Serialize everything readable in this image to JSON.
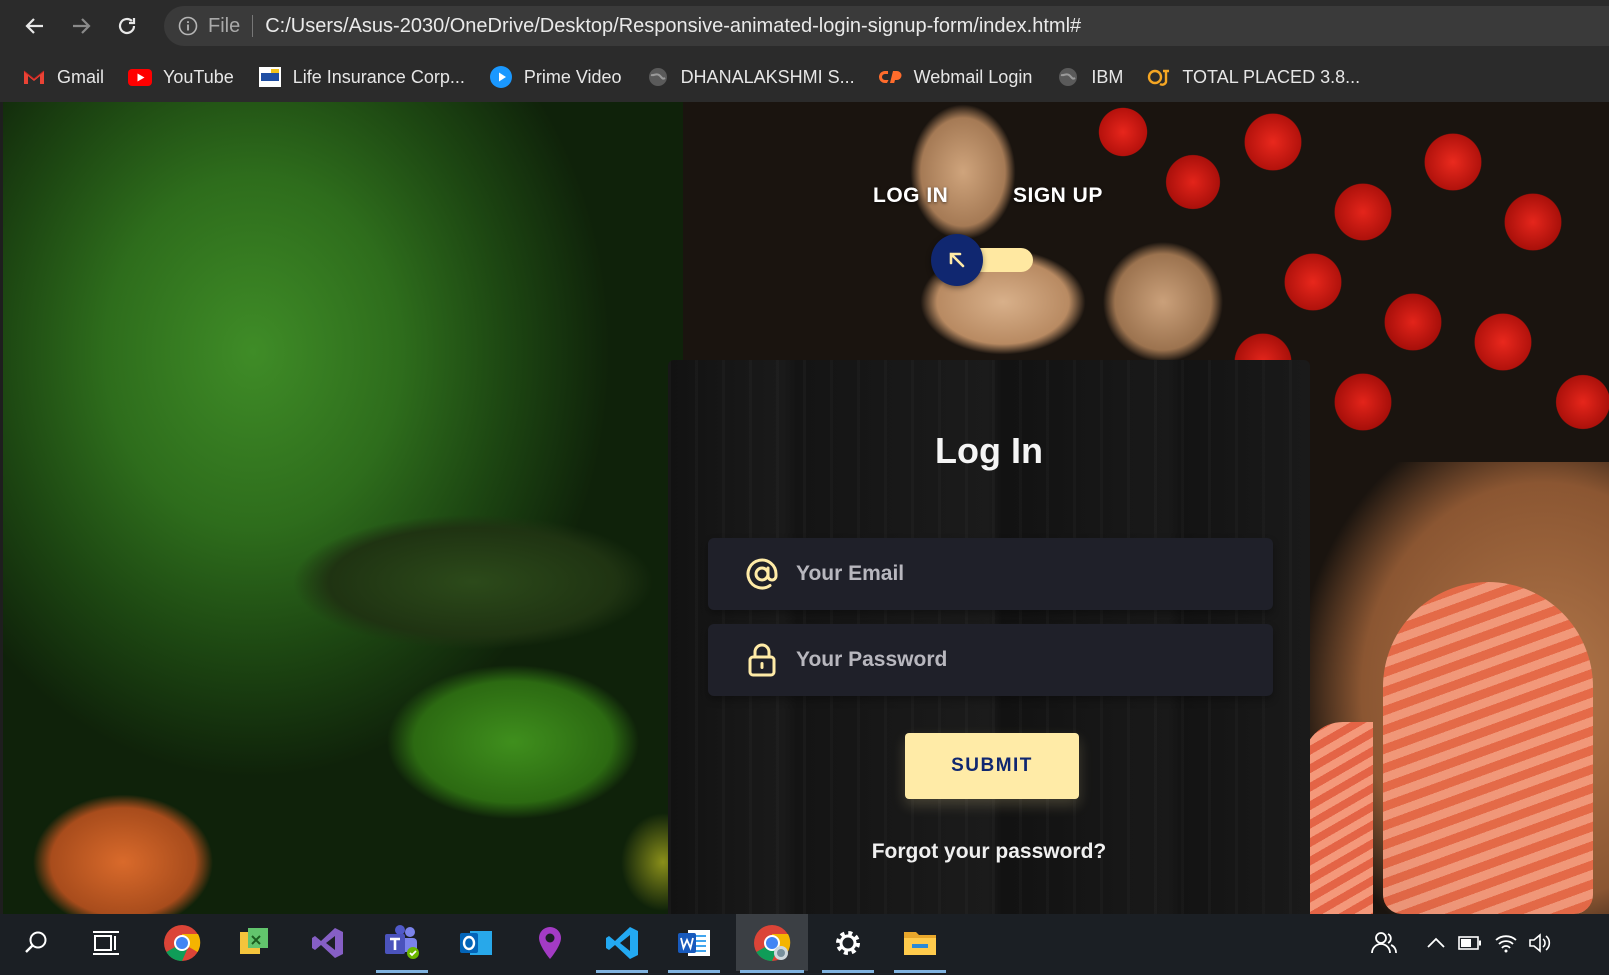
{
  "browser": {
    "nav": {
      "back_icon": "arrow-left-icon",
      "forward_icon": "arrow-right-icon",
      "reload_icon": "reload-icon"
    },
    "omnibox": {
      "info_icon": "info-icon",
      "scheme_label": "File",
      "url": "C:/Users/Asus-2030/OneDrive/Desktop/Responsive-animated-login-signup-form/index.html#"
    },
    "bookmarks": [
      {
        "label": "Gmail",
        "icon": "gmail-icon"
      },
      {
        "label": "YouTube",
        "icon": "youtube-icon"
      },
      {
        "label": "Life Insurance Corp...",
        "icon": "lic-icon"
      },
      {
        "label": "Prime Video",
        "icon": "prime-video-icon"
      },
      {
        "label": "DHANALAKSHMI S...",
        "icon": "globe-icon"
      },
      {
        "label": "Webmail Login",
        "icon": "cpanel-icon"
      },
      {
        "label": "IBM",
        "icon": "globe-icon"
      },
      {
        "label": "TOTAL PLACED 3.8...",
        "icon": "faceprep-icon"
      }
    ]
  },
  "toggle": {
    "login_label": "LOG IN",
    "signup_label": "SIGN UP",
    "knob_icon": "arrow-up-left-icon"
  },
  "form": {
    "title": "Log In",
    "email_placeholder": "Your Email",
    "password_placeholder": "Your Password",
    "submit_label": "SUBMIT",
    "forgot_label": "Forgot your password?"
  },
  "taskbar": {
    "apps": [
      "search-icon",
      "task-view-icon",
      "chrome-icon",
      "file-manager-icon",
      "visual-studio-icon",
      "teams-icon",
      "outlook-icon",
      "maps-icon",
      "vscode-icon",
      "word-icon",
      "chrome-canary-icon",
      "settings-icon",
      "file-explorer-icon"
    ],
    "tray": [
      "people-icon",
      "chevron-up-icon",
      "battery-icon",
      "wifi-icon",
      "volume-icon"
    ]
  },
  "colors": {
    "accent": "#ffeba7",
    "knob": "#102770",
    "field_bg": "#1f2029",
    "chrome_bg": "#2b2b2b"
  }
}
